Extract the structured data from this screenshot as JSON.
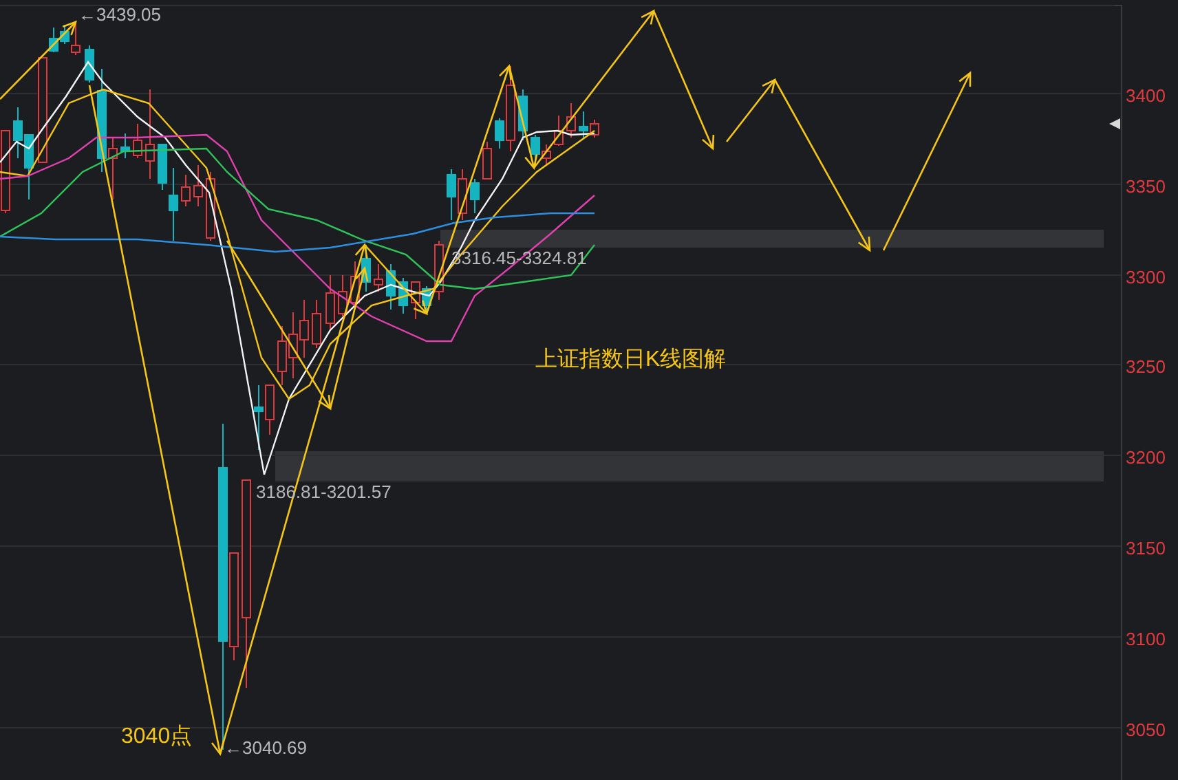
{
  "chart": {
    "title": "上证指数日K线图解",
    "low_callout": "3040点",
    "price_notes": [
      "←3439.05",
      "3316.45-3324.81",
      "3186.81-3201.57",
      "←3040.69"
    ]
  },
  "price_axis": {
    "labels": [
      "3400",
      "3350",
      "3300",
      "3250",
      "3200",
      "3150",
      "3100",
      "3050"
    ]
  }
}
